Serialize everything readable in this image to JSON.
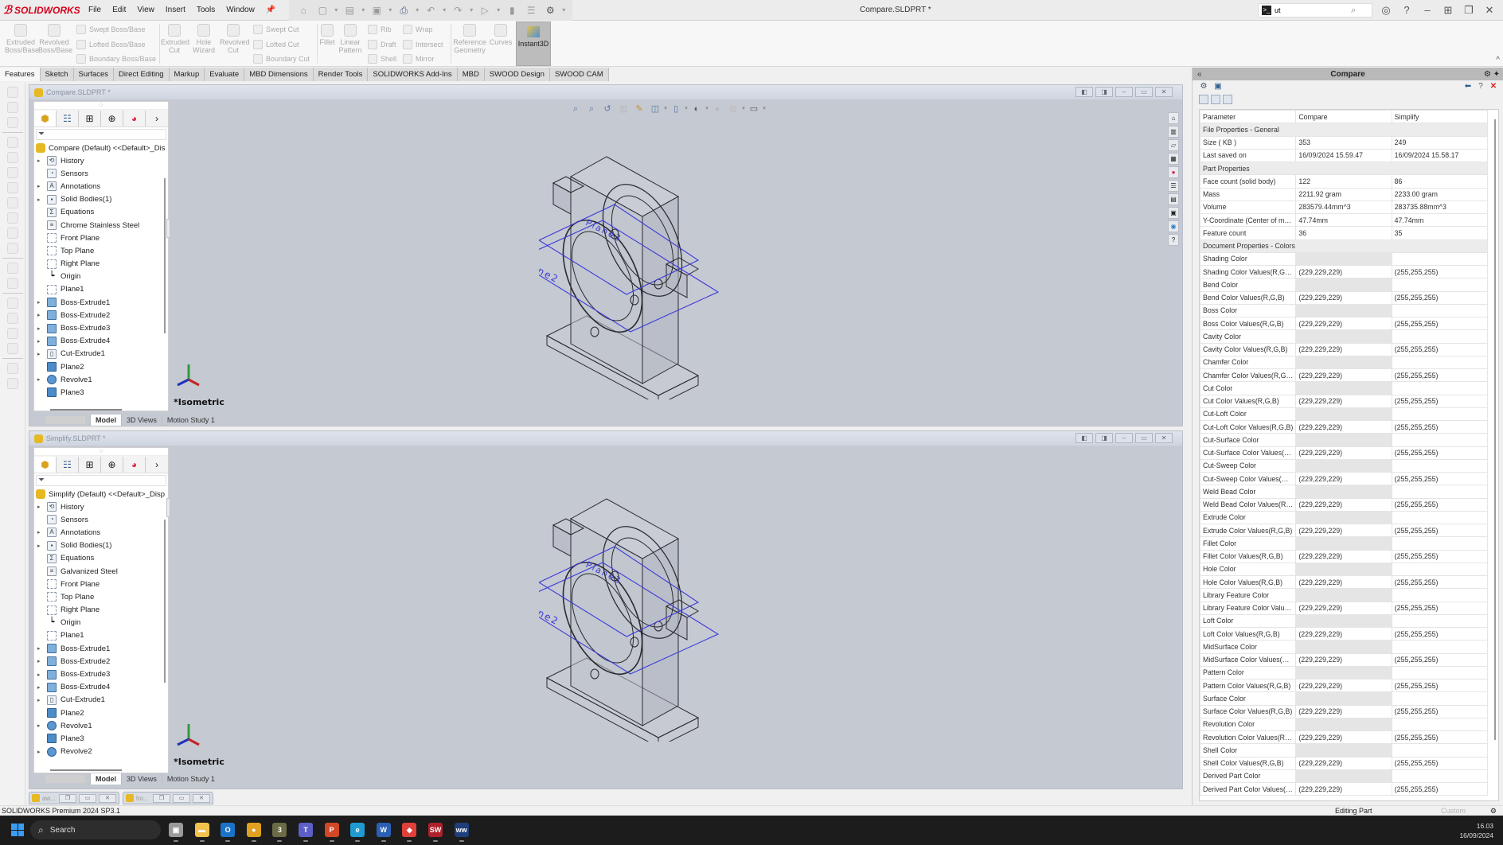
{
  "app": {
    "brand": "SOLIDWORKS",
    "document_title": "Compare.SLDPRT *",
    "menu": [
      "File",
      "Edit",
      "View",
      "Insert",
      "Tools",
      "Window"
    ],
    "search_value": "ut",
    "quick_access_icons": [
      "home-icon",
      "new-icon",
      "open-icon",
      "save-icon",
      "print-icon",
      "undo-icon",
      "redo-icon",
      "select-icon",
      "rebuild-icon",
      "file-properties-icon",
      "options-icon"
    ]
  },
  "ribbon": {
    "large_buttons": [
      {
        "label": "Extruded Boss/Base",
        "icon": "extruded-boss-icon"
      },
      {
        "label": "Revolved Boss/Base",
        "icon": "revolved-boss-icon"
      },
      {
        "label": "Extruded Cut",
        "icon": "extruded-cut-icon"
      },
      {
        "label": "Hole Wizard",
        "icon": "hole-wizard-icon"
      },
      {
        "label": "Revolved Cut",
        "icon": "revolved-cut-icon"
      },
      {
        "label": "Fillet",
        "icon": "fillet-icon"
      },
      {
        "label": "Linear Pattern",
        "icon": "linear-pattern-icon"
      },
      {
        "label": "Reference Geometry",
        "icon": "reference-geometry-icon"
      },
      {
        "label": "Curves",
        "icon": "curves-icon"
      }
    ],
    "small_buttons": [
      {
        "label": "Swept Boss/Base",
        "icon": "swept-boss-icon"
      },
      {
        "label": "Lofted Boss/Base",
        "icon": "lofted-boss-icon"
      },
      {
        "label": "Boundary Boss/Base",
        "icon": "boundary-boss-icon"
      },
      {
        "label": "Swept Cut",
        "icon": "swept-cut-icon"
      },
      {
        "label": "Lofted Cut",
        "icon": "lofted-cut-icon"
      },
      {
        "label": "Boundary Cut",
        "icon": "boundary-cut-icon"
      },
      {
        "label": "Rib",
        "icon": "rib-icon"
      },
      {
        "label": "Draft",
        "icon": "draft-icon"
      },
      {
        "label": "Shell",
        "icon": "shell-icon"
      },
      {
        "label": "Wrap",
        "icon": "wrap-icon"
      },
      {
        "label": "Intersect",
        "icon": "intersect-icon"
      },
      {
        "label": "Mirror",
        "icon": "mirror-icon"
      }
    ],
    "instant3d_label": "Instant3D",
    "tabs": [
      "Features",
      "Sketch",
      "Surfaces",
      "Direct Editing",
      "Markup",
      "Evaluate",
      "MBD Dimensions",
      "Render Tools",
      "SOLIDWORKS Add-Ins",
      "MBD",
      "SWOOD Design",
      "SWOOD CAM"
    ],
    "active_tab": "Features"
  },
  "viewports": [
    {
      "title": "Compare.SLDPRT *",
      "root": "Compare (Default) <<Default>_Dis",
      "tree": [
        {
          "label": "History",
          "icon": "history-icon",
          "expandable": true
        },
        {
          "label": "Sensors",
          "icon": "sensors-icon",
          "expandable": false
        },
        {
          "label": "Annotations",
          "icon": "annotations-icon",
          "expandable": true
        },
        {
          "label": "Solid Bodies(1)",
          "icon": "solid-bodies-icon",
          "expandable": true
        },
        {
          "label": "Equations",
          "icon": "equations-icon",
          "expandable": false
        },
        {
          "label": "Chrome Stainless Steel",
          "icon": "material-icon",
          "expandable": false
        },
        {
          "label": "Front Plane",
          "icon": "plane-icon",
          "expandable": false
        },
        {
          "label": "Top Plane",
          "icon": "plane-icon",
          "expandable": false
        },
        {
          "label": "Right Plane",
          "icon": "plane-icon",
          "expandable": false
        },
        {
          "label": "Origin",
          "icon": "origin-icon",
          "expandable": false
        },
        {
          "label": "Plane1",
          "icon": "plane-icon",
          "expandable": false
        },
        {
          "label": "Boss-Extrude1",
          "icon": "boss-extrude-icon",
          "expandable": true
        },
        {
          "label": "Boss-Extrude2",
          "icon": "boss-extrude-icon",
          "expandable": true
        },
        {
          "label": "Boss-Extrude3",
          "icon": "boss-extrude-icon",
          "expandable": true
        },
        {
          "label": "Boss-Extrude4",
          "icon": "boss-extrude-icon",
          "expandable": true
        },
        {
          "label": "Cut-Extrude1",
          "icon": "cut-extrude-icon",
          "expandable": true
        },
        {
          "label": "Plane2",
          "icon": "plane-feature-icon",
          "expandable": false
        },
        {
          "label": "Revolve1",
          "icon": "revolve-icon",
          "expandable": true
        },
        {
          "label": "Plane3",
          "icon": "plane-feature-icon",
          "expandable": false
        }
      ],
      "view_label": "*Isometric",
      "plane_labels": [
        "Plane2",
        "Plane3"
      ],
      "bottom_tabs": [
        "Model",
        "3D Views",
        "Motion Study 1"
      ]
    },
    {
      "title": "Simplify.SLDPRT *",
      "root": "Simplify (Default) <<Default>_Disp",
      "tree": [
        {
          "label": "History",
          "icon": "history-icon",
          "expandable": true
        },
        {
          "label": "Sensors",
          "icon": "sensors-icon",
          "expandable": false
        },
        {
          "label": "Annotations",
          "icon": "annotations-icon",
          "expandable": true
        },
        {
          "label": "Solid Bodies(1)",
          "icon": "solid-bodies-icon",
          "expandable": true
        },
        {
          "label": "Equations",
          "icon": "equations-icon",
          "expandable": false
        },
        {
          "label": "Galvanized Steel",
          "icon": "material-icon",
          "expandable": false
        },
        {
          "label": "Front Plane",
          "icon": "plane-icon",
          "expandable": false
        },
        {
          "label": "Top Plane",
          "icon": "plane-icon",
          "expandable": false
        },
        {
          "label": "Right Plane",
          "icon": "plane-icon",
          "expandable": false
        },
        {
          "label": "Origin",
          "icon": "origin-icon",
          "expandable": false
        },
        {
          "label": "Plane1",
          "icon": "plane-icon",
          "expandable": false
        },
        {
          "label": "Boss-Extrude1",
          "icon": "boss-extrude-icon",
          "expandable": true
        },
        {
          "label": "Boss-Extrude2",
          "icon": "boss-extrude-icon",
          "expandable": true
        },
        {
          "label": "Boss-Extrude3",
          "icon": "boss-extrude-icon",
          "expandable": true
        },
        {
          "label": "Boss-Extrude4",
          "icon": "boss-extrude-icon",
          "expandable": true
        },
        {
          "label": "Cut-Extrude1",
          "icon": "cut-extrude-icon",
          "expandable": true
        },
        {
          "label": "Plane2",
          "icon": "plane-feature-icon",
          "expandable": false
        },
        {
          "label": "Revolve1",
          "icon": "revolve-icon",
          "expandable": true
        },
        {
          "label": "Plane3",
          "icon": "plane-feature-icon",
          "expandable": false
        },
        {
          "label": "Revolve2",
          "icon": "revolve-icon",
          "expandable": true
        }
      ],
      "view_label": "*Isometric",
      "plane_labels": [
        "Plane2",
        "Plane3"
      ],
      "bottom_tabs": [
        "Model",
        "3D Views",
        "Motion Study 1"
      ]
    }
  ],
  "minimized_docs": [
    {
      "name": "aw..."
    },
    {
      "name": "ho..."
    }
  ],
  "compare_panel": {
    "title": "Compare",
    "columns": [
      "Parameter",
      "Compare",
      "Simplify"
    ],
    "swatch_colors": {
      "compare": "#e5e5e5",
      "simplify": "#ffffff"
    },
    "rows": [
      {
        "type": "section",
        "label": "File Properties - General"
      },
      {
        "type": "data",
        "label": "Size ( KB )",
        "compare": "353",
        "simplify": "249"
      },
      {
        "type": "data",
        "label": "Last saved on",
        "compare": "16/09/2024 15.59.47",
        "simplify": "16/09/2024 15.58.17"
      },
      {
        "type": "section",
        "label": "Part Properties"
      },
      {
        "type": "data",
        "label": "Face count (solid body)",
        "compare": "122",
        "simplify": "86"
      },
      {
        "type": "data",
        "label": "Mass",
        "compare": "2211.92 gram",
        "simplify": "2233.00 gram"
      },
      {
        "type": "data",
        "label": "Volume",
        "compare": "283579.44mm^3",
        "simplify": "283735.88mm^3"
      },
      {
        "type": "data",
        "label": "Y-Coordinate (Center of mass)",
        "compare": "47.74mm",
        "simplify": "47.74mm"
      },
      {
        "type": "data",
        "label": "Feature count",
        "compare": "36",
        "simplify": "35"
      },
      {
        "type": "section",
        "label": "Document Properties - Colors"
      },
      {
        "type": "swatch",
        "label": "Shading Color"
      },
      {
        "type": "data",
        "label": "Shading Color Values(R,G,B)",
        "compare": "(229,229,229)",
        "simplify": "(255,255,255)"
      },
      {
        "type": "swatch",
        "label": "Bend Color"
      },
      {
        "type": "data",
        "label": "Bend Color Values(R,G,B)",
        "compare": "(229,229,229)",
        "simplify": "(255,255,255)"
      },
      {
        "type": "swatch",
        "label": "Boss Color"
      },
      {
        "type": "data",
        "label": "Boss Color Values(R,G,B)",
        "compare": "(229,229,229)",
        "simplify": "(255,255,255)"
      },
      {
        "type": "swatch",
        "label": "Cavity Color"
      },
      {
        "type": "data",
        "label": "Cavity Color Values(R,G,B)",
        "compare": "(229,229,229)",
        "simplify": "(255,255,255)"
      },
      {
        "type": "swatch",
        "label": "Chamfer Color"
      },
      {
        "type": "data",
        "label": "Chamfer Color Values(R,G,B)",
        "compare": "(229,229,229)",
        "simplify": "(255,255,255)"
      },
      {
        "type": "swatch",
        "label": "Cut Color"
      },
      {
        "type": "data",
        "label": "Cut Color Values(R,G,B)",
        "compare": "(229,229,229)",
        "simplify": "(255,255,255)"
      },
      {
        "type": "swatch",
        "label": "Cut-Loft Color"
      },
      {
        "type": "data",
        "label": "Cut-Loft Color Values(R,G,B)",
        "compare": "(229,229,229)",
        "simplify": "(255,255,255)"
      },
      {
        "type": "swatch",
        "label": "Cut-Surface Color"
      },
      {
        "type": "data",
        "label": "Cut-Surface Color Values(R,G,B)",
        "compare": "(229,229,229)",
        "simplify": "(255,255,255)"
      },
      {
        "type": "swatch",
        "label": "Cut-Sweep Color"
      },
      {
        "type": "data",
        "label": "Cut-Sweep Color Values(R,G,B)",
        "compare": "(229,229,229)",
        "simplify": "(255,255,255)"
      },
      {
        "type": "swatch",
        "label": "Weld Bead Color"
      },
      {
        "type": "data",
        "label": "Weld Bead Color Values(R,G,B)",
        "compare": "(229,229,229)",
        "simplify": "(255,255,255)"
      },
      {
        "type": "swatch",
        "label": "Extrude Color"
      },
      {
        "type": "data",
        "label": "Extrude Color Values(R,G,B)",
        "compare": "(229,229,229)",
        "simplify": "(255,255,255)"
      },
      {
        "type": "swatch",
        "label": "Fillet Color"
      },
      {
        "type": "data",
        "label": "Fillet Color Values(R,G,B)",
        "compare": "(229,229,229)",
        "simplify": "(255,255,255)"
      },
      {
        "type": "swatch",
        "label": "Hole Color"
      },
      {
        "type": "data",
        "label": "Hole Color Values(R,G,B)",
        "compare": "(229,229,229)",
        "simplify": "(255,255,255)"
      },
      {
        "type": "swatch",
        "label": "Library Feature Color"
      },
      {
        "type": "data",
        "label": "Library Feature Color Values(...",
        "compare": "(229,229,229)",
        "simplify": "(255,255,255)"
      },
      {
        "type": "swatch",
        "label": "Loft Color"
      },
      {
        "type": "data",
        "label": "Loft Color Values(R,G,B)",
        "compare": "(229,229,229)",
        "simplify": "(255,255,255)"
      },
      {
        "type": "swatch",
        "label": "MidSurface Color"
      },
      {
        "type": "data",
        "label": "MidSurface Color Values(R,G,B)",
        "compare": "(229,229,229)",
        "simplify": "(255,255,255)"
      },
      {
        "type": "swatch",
        "label": "Pattern Color"
      },
      {
        "type": "data",
        "label": "Pattern Color Values(R,G,B)",
        "compare": "(229,229,229)",
        "simplify": "(255,255,255)"
      },
      {
        "type": "swatch",
        "label": "Surface Color"
      },
      {
        "type": "data",
        "label": "Surface Color Values(R,G,B)",
        "compare": "(229,229,229)",
        "simplify": "(255,255,255)"
      },
      {
        "type": "swatch",
        "label": "Revolution Color"
      },
      {
        "type": "data",
        "label": "Revolution Color Values(R,G,B)",
        "compare": "(229,229,229)",
        "simplify": "(255,255,255)"
      },
      {
        "type": "swatch",
        "label": "Shell Color"
      },
      {
        "type": "data",
        "label": "Shell Color Values(R,G,B)",
        "compare": "(229,229,229)",
        "simplify": "(255,255,255)"
      },
      {
        "type": "swatch",
        "label": "Derived Part Color"
      },
      {
        "type": "data",
        "label": "Derived Part Color Values(R,G...",
        "compare": "(229,229,229)",
        "simplify": "(255,255,255)"
      }
    ]
  },
  "statusbar": {
    "product": "SOLIDWORKS Premium 2024 SP3.1",
    "mode": "Editing Part",
    "units": "Custom"
  },
  "taskbar": {
    "search_placeholder": "Search",
    "apps": [
      {
        "name": "task-view",
        "color": "#9a9a9a",
        "glyph": "▣"
      },
      {
        "name": "file-explorer",
        "color": "#f2c14e",
        "glyph": "▬"
      },
      {
        "name": "outlook",
        "color": "#1a73c9",
        "glyph": "O"
      },
      {
        "name": "chrome",
        "color": "#e0a020",
        "glyph": "●"
      },
      {
        "name": "app-3",
        "color": "#6b6b45",
        "glyph": "3"
      },
      {
        "name": "teams",
        "color": "#5b5fc7",
        "glyph": "T"
      },
      {
        "name": "powerpoint",
        "color": "#d24726",
        "glyph": "P"
      },
      {
        "name": "edge",
        "color": "#1f9bd1",
        "glyph": "e"
      },
      {
        "name": "word",
        "color": "#2b5fb4",
        "glyph": "W"
      },
      {
        "name": "anydesk",
        "color": "#e0403b",
        "glyph": "◆"
      },
      {
        "name": "solidworks-2024",
        "color": "#b0202a",
        "glyph": "SW"
      },
      {
        "name": "app-ww",
        "color": "#1f3f7a",
        "glyph": "ww"
      }
    ],
    "time": "16.03",
    "date": "16/09/2024"
  }
}
